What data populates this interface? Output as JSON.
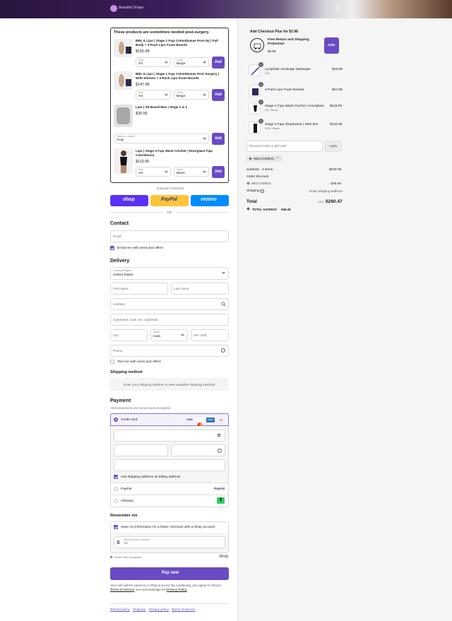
{
  "header": {
    "logo_text": "Beautiful Shape"
  },
  "upsell": {
    "title": "These products are sometimes needed post-surgery.",
    "products": [
      {
        "name_line1": "BBL & Lipo | Stage 1 Faja Colombianas Post-Op | Full",
        "name_line2": "Body + 3-Pack Lipo Foam Boards",
        "price": "$155.98",
        "size_label": "Size",
        "size_value": "XS",
        "color_label": "Color",
        "color_value": "Beige",
        "add_label": "Add"
      },
      {
        "name_line1": "BBL & Lipo | Stage 1 Faja Colombianas Post Surgery |",
        "name_line2": "With Sleeves + 3-Pack Lipo Foam Boards",
        "price": "$147.98",
        "size_label": "Size",
        "size_value": "XS",
        "color_label": "Color",
        "color_value": "Beige",
        "add_label": "Add"
      },
      {
        "name_line1": "Lipo | Ab Board Max | Stage 2 & 3",
        "name_line2": "",
        "price": "$39.99",
        "variant_label": "Select a variant",
        "variant_value": "Gray",
        "add_label": "Add"
      },
      {
        "name_line1": "Lipo | Stage 4 Faja Waist Cincher | Hourglass Faja",
        "name_line2": "Colombiana",
        "price": "$119.99",
        "size_label": "Size",
        "size_value": "XS",
        "color_label": "Color",
        "color_value": "Black",
        "add_label": "Add"
      }
    ]
  },
  "express": {
    "label": "Express checkout",
    "shop": "shop",
    "paypal": "PayPal",
    "venmo": "venmo",
    "or": "OR"
  },
  "contact": {
    "title": "Contact",
    "email_placeholder": "Email",
    "news_label": "Email me with news and offers"
  },
  "delivery": {
    "title": "Delivery",
    "country_label": "Country/Region",
    "country_value": "United States",
    "first_name": "First name",
    "last_name": "Last name",
    "address": "Address",
    "apartment": "Apartment, suite, etc. (optional)",
    "city": "City",
    "state_label": "State",
    "state_value": "Iowa",
    "zip": "ZIP code",
    "phone": "Phone",
    "text_label": "Text me with news and offers"
  },
  "shipping_method": {
    "title": "Shipping method",
    "message": "Enter your shipping address to view available shipping methods."
  },
  "payment": {
    "title": "Payment",
    "subtitle": "All transactions are secure and encrypted.",
    "credit_card": "Credit card",
    "cards": [
      "VISA",
      "MC",
      "AMEX"
    ],
    "more": "+1",
    "billing_label": "Use shipping address as billing address",
    "paypal": "PayPal",
    "afterpay": "Afterpay"
  },
  "remember": {
    "title": "Remember me",
    "save_label": "Save my information for a faster checkout with a Shop account",
    "mobile_label": "Mobile phone number",
    "mobile_value": "+1",
    "secure": "Secure and encrypted",
    "shop": "shop"
  },
  "pay_button": "Pay now",
  "legal": {
    "line1": "Your info will be saved to a Shop account. By continuing, you agree to Shop's",
    "terms": "Terms of Service",
    "and": "and acknowledge the",
    "privacy": "Privacy Policy",
    "dot": "."
  },
  "footer_links": [
    "Refund policy",
    "Shipping",
    "Privacy policy",
    "Terms of service"
  ],
  "summary": {
    "addon": {
      "title": "Add Checkout Plus for $3.98",
      "name_line1": "Free Return and Shipping",
      "name_line2": "Protection",
      "price": "$3.98",
      "button": "ADD"
    },
    "items": [
      {
        "qty": "1",
        "name": "Lymphatic Drainage Massager",
        "variant": "Lila",
        "price": "$19.99"
      },
      {
        "qty": "1",
        "name": "3-Pack Lipo Foam Boards",
        "variant": "",
        "price": "$34.99"
      },
      {
        "qty": "1",
        "name": "Stage 4 Faja Waist Cincher | Hourglass",
        "variant": "XS / Black",
        "price": "$119.99"
      },
      {
        "qty": "1",
        "name": "Stage 2 Faja Shapewear | With Bra",
        "variant": "2XS / Black",
        "price": "$154.99"
      }
    ],
    "discount_placeholder": "Discount code or gift card",
    "apply": "Apply",
    "code_tag": "WELCOME15",
    "subtotal_label": "Subtotal · 4 items",
    "subtotal_value": "$329.96",
    "order_discount_label": "Order discount",
    "discount_code": "WELCOME15",
    "discount_value": "- $49.49",
    "shipping_label": "Shipping",
    "shipping_value": "Enter shipping address",
    "total_label": "Total",
    "currency": "USD",
    "total_value": "$280.47",
    "savings_label": "TOTAL SAVINGS",
    "savings_value": "$49.49"
  },
  "colors": {
    "accent": "#6a4bc3",
    "shop": "#5a31f4",
    "paypal": "#ffc439",
    "venmo": "#008cff"
  }
}
